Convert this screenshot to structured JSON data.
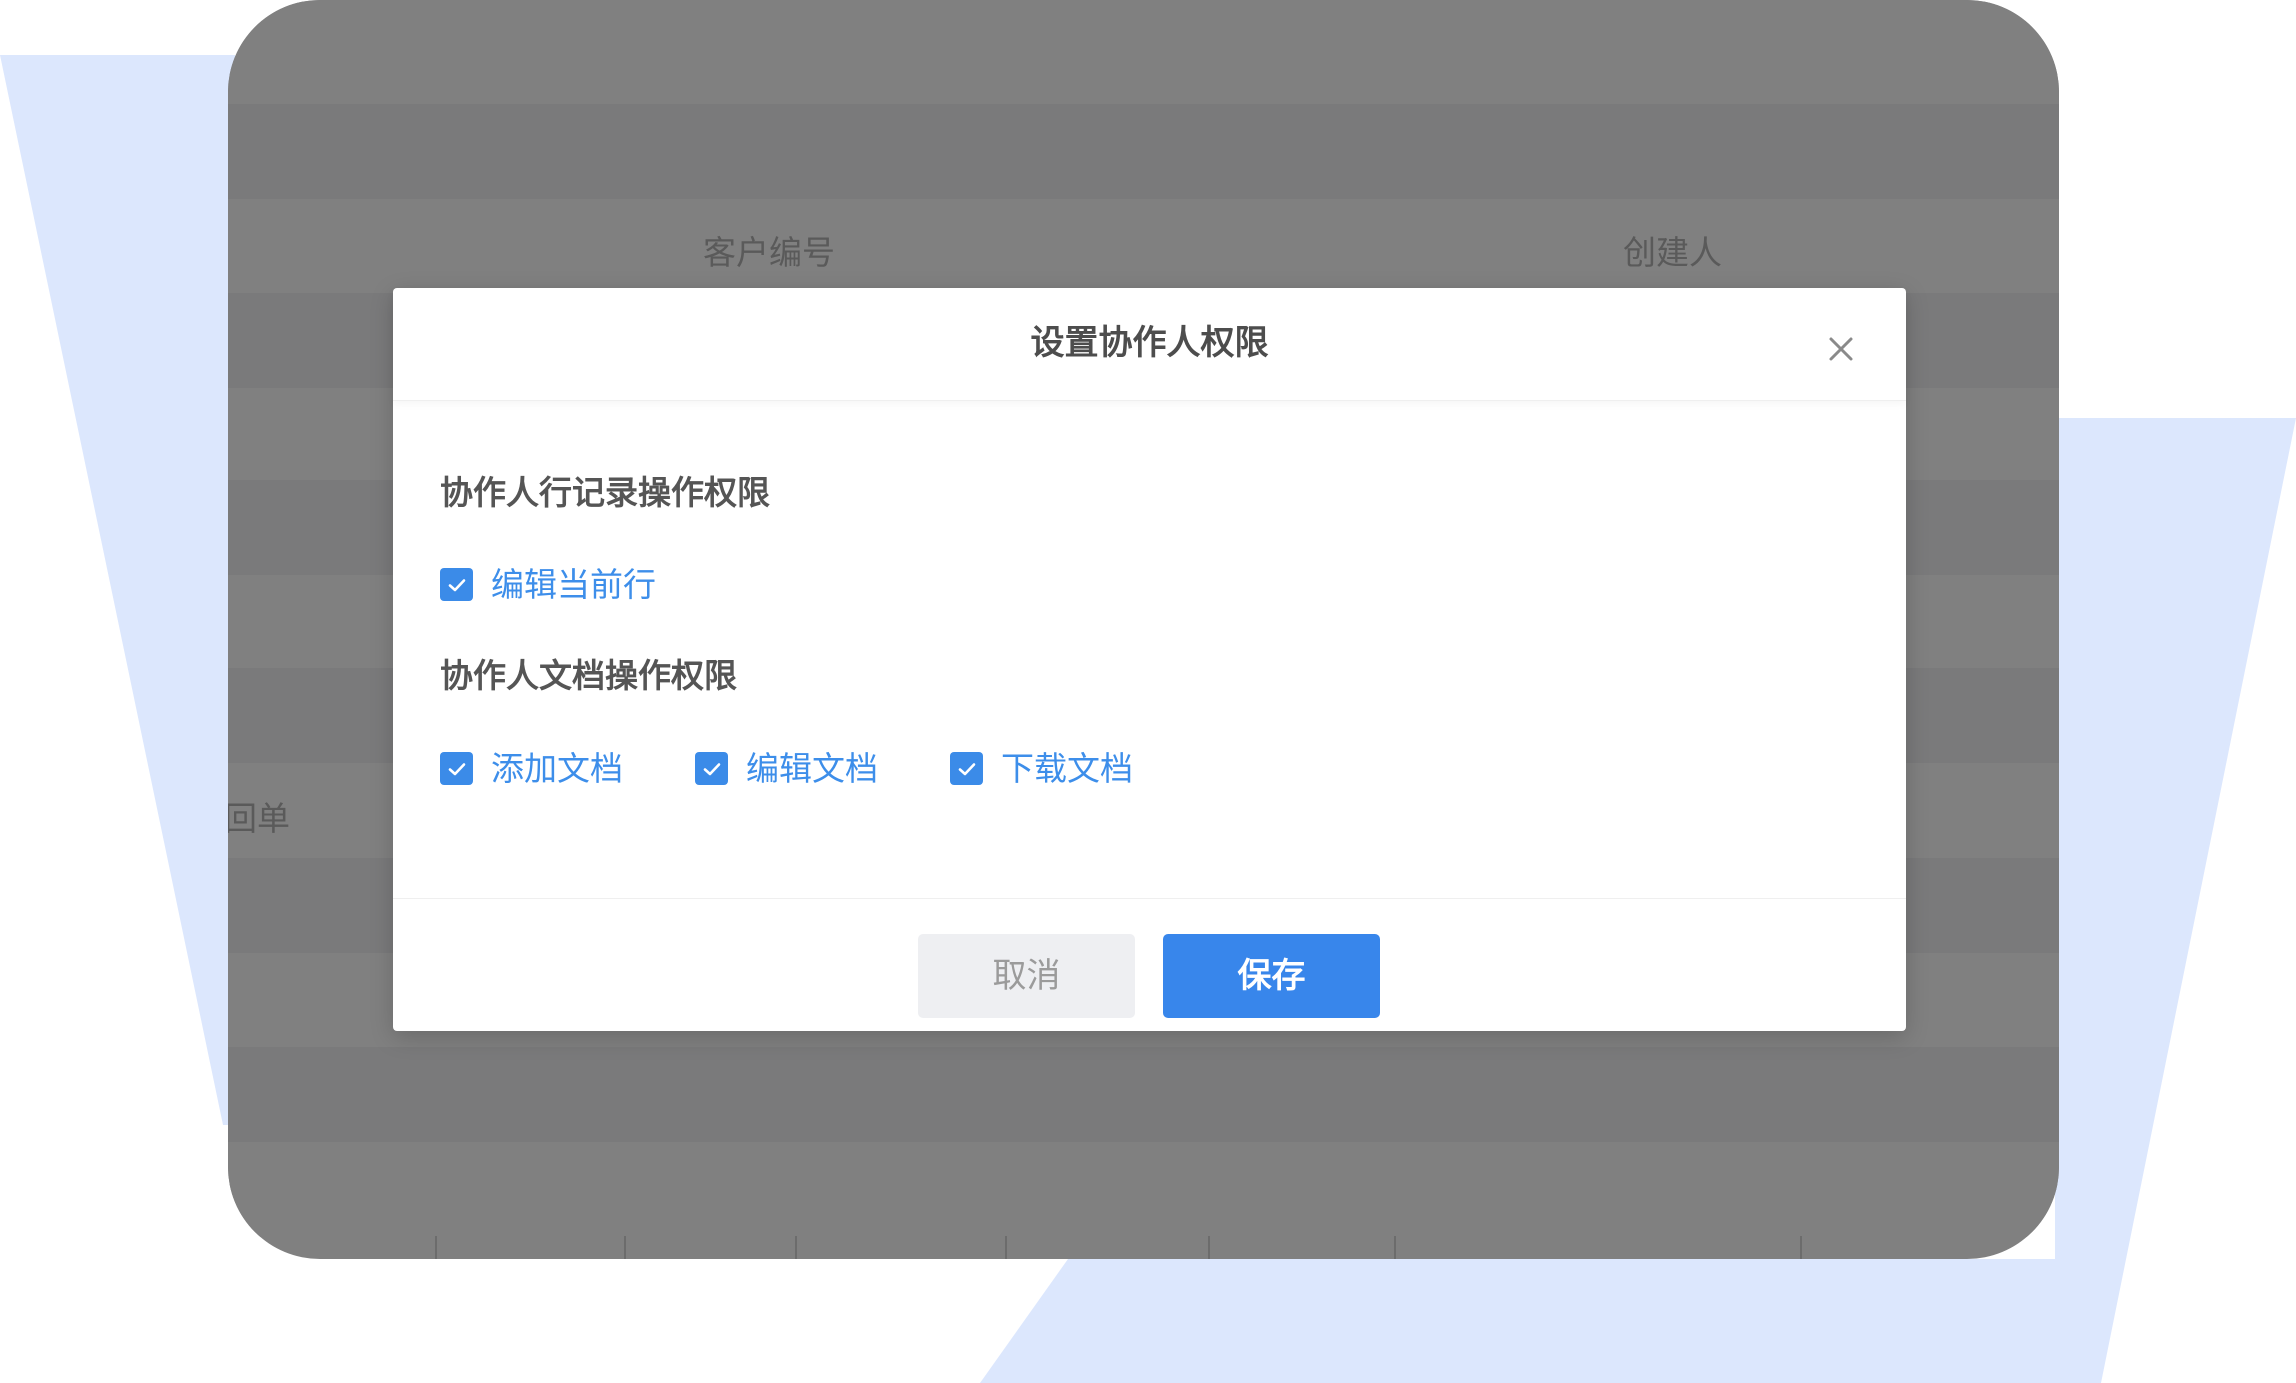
{
  "background": {
    "column_headers": [
      "客户编号",
      "创建人"
    ],
    "row_fragment": "回单",
    "accent_color": "#dce7fd",
    "overlay_color": "#808080"
  },
  "dialog": {
    "title": "设置协作人权限",
    "close_icon": "close-icon",
    "sections": [
      {
        "label": "协作人行记录操作权限",
        "options": [
          {
            "label": "编辑当前行",
            "checked": true
          }
        ]
      },
      {
        "label": "协作人文档操作权限",
        "options": [
          {
            "label": "添加文档",
            "checked": true
          },
          {
            "label": "编辑文档",
            "checked": true
          },
          {
            "label": "下载文档",
            "checked": true
          }
        ]
      }
    ],
    "buttons": {
      "cancel": "取消",
      "save": "保存"
    },
    "accent_color": "#3886eb"
  }
}
